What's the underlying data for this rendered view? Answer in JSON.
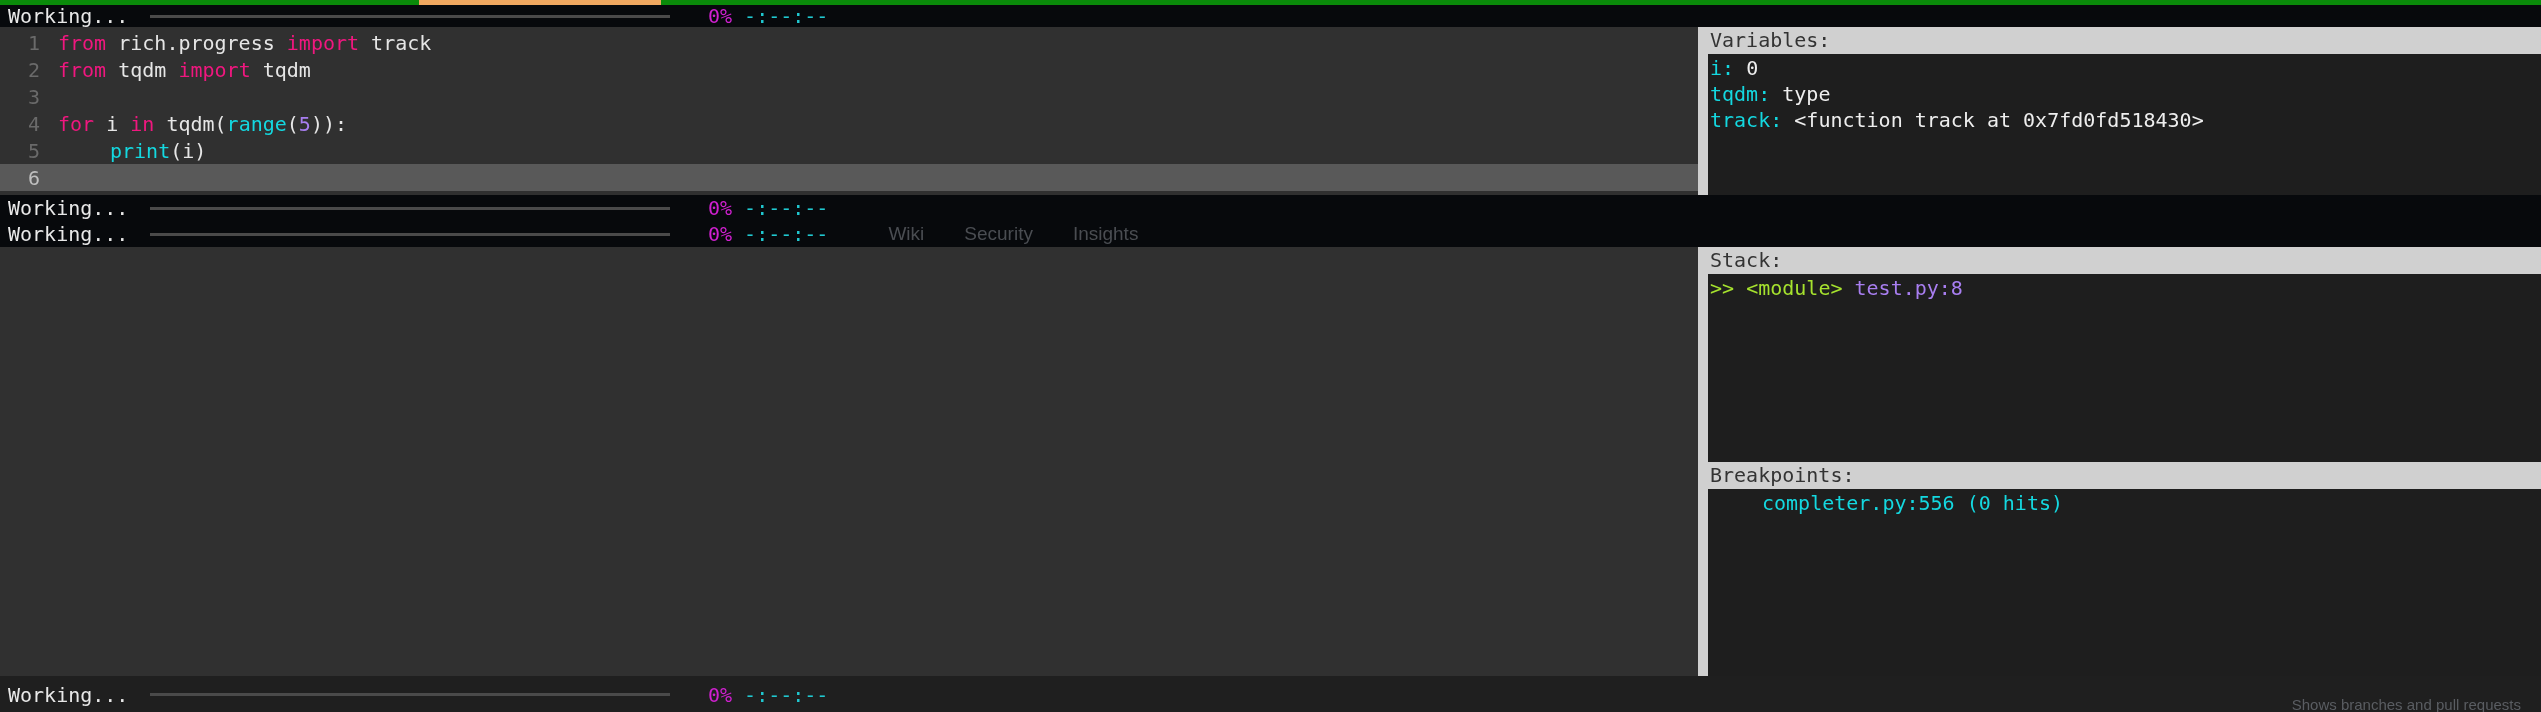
{
  "progress_lines": [
    {
      "label": "Working...",
      "level": 0,
      "percent": "0%",
      "eta": "-:--:--"
    },
    {
      "label": "Working...",
      "level": 0,
      "percent": "0%",
      "eta": "-:--:--"
    },
    {
      "label": "Working...",
      "level": 0,
      "percent": "0%",
      "eta": "-:--:--"
    },
    {
      "label": "Working...",
      "level": 0,
      "percent": "0%",
      "eta": "-:--:--"
    }
  ],
  "editor": {
    "lines": [
      {
        "number": "1",
        "selected": false,
        "tokens": [
          {
            "text": "from",
            "kind": "keyword"
          },
          {
            "text": " rich.progress ",
            "kind": "plain"
          },
          {
            "text": "import",
            "kind": "keyword"
          },
          {
            "text": " track",
            "kind": "plain"
          }
        ]
      },
      {
        "number": "2",
        "selected": false,
        "tokens": [
          {
            "text": "from",
            "kind": "keyword"
          },
          {
            "text": " tqdm ",
            "kind": "plain"
          },
          {
            "text": "import",
            "kind": "keyword"
          },
          {
            "text": " tqdm",
            "kind": "plain"
          }
        ]
      },
      {
        "number": "3",
        "selected": false
      },
      {
        "number": "4",
        "selected": false,
        "tokens": [
          {
            "text": "for",
            "kind": "keyword"
          },
          {
            "text": " i ",
            "kind": "plain"
          },
          {
            "text": "in",
            "kind": "keyword"
          },
          {
            "text": " tqdm(",
            "kind": "plain"
          },
          {
            "text": "range",
            "kind": "builtin"
          },
          {
            "text": "(",
            "kind": "plain"
          },
          {
            "text": "5",
            "kind": "number"
          },
          {
            "text": ")):",
            "kind": "plain"
          }
        ]
      },
      {
        "number": "5",
        "selected": false,
        "indented": true,
        "tokens": [
          {
            "text": "print",
            "kind": "builtin"
          },
          {
            "text": "(i)",
            "kind": "plain"
          }
        ]
      },
      {
        "number": "6",
        "selected": true
      }
    ]
  },
  "variables": {
    "title": "Variables:",
    "items": [
      {
        "name": "i:",
        "value": "0"
      },
      {
        "name": "tqdm:",
        "value": "type"
      },
      {
        "name": "track:",
        "value": "<function track at 0x7fd0fd518430>"
      }
    ]
  },
  "background_page": {
    "tabs": [
      "Wiki",
      "Security",
      "Insights"
    ],
    "hint": "Shows branches and pull requests"
  },
  "stack": {
    "title": "Stack:",
    "frames": [
      {
        "marker": ">>",
        "name": "<module>",
        "location": "test.py:8"
      }
    ]
  },
  "breakpoints": {
    "title": "Breakpoints:",
    "items": [
      "completer.py:556 (0 hits)"
    ]
  }
}
